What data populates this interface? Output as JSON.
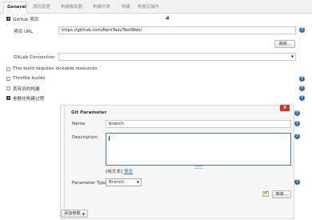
{
  "tabs": [
    "General",
    "源码管理",
    "构建触发器",
    "构建环境",
    "构建",
    "构建后操作"
  ],
  "general": {
    "github_project_label": "GitHub 项目",
    "project_url_label": "项目 URL",
    "project_url_value": "https://github.com/KentTain/TestWeb/",
    "advanced_label": "高级...",
    "gitlab_connection_label": "GitLab Connection",
    "gitlab_connection_value": "",
    "lockable_label": "This build requires lockable resources",
    "throttle_label": "Throttle builds",
    "discard_label": "丢弃旧的构建",
    "parameterized_label": "参数化构建过程"
  },
  "git_parameter": {
    "title": "Git Parameter",
    "delete_label": "X",
    "name_label": "Name",
    "name_value": "branch",
    "description_label": "Description",
    "description_value": "",
    "plain_text_label": "[纯文本]",
    "preview_label": "预览",
    "parameter_type_label": "Parameter Type",
    "parameter_type_value": "Branch",
    "advanced_label": "高级..."
  },
  "add_parameter_label": "添加参数",
  "colors": {
    "accent": "#2f6fb3",
    "delete": "#d8302b",
    "checkbox": "#4a4a4a"
  }
}
